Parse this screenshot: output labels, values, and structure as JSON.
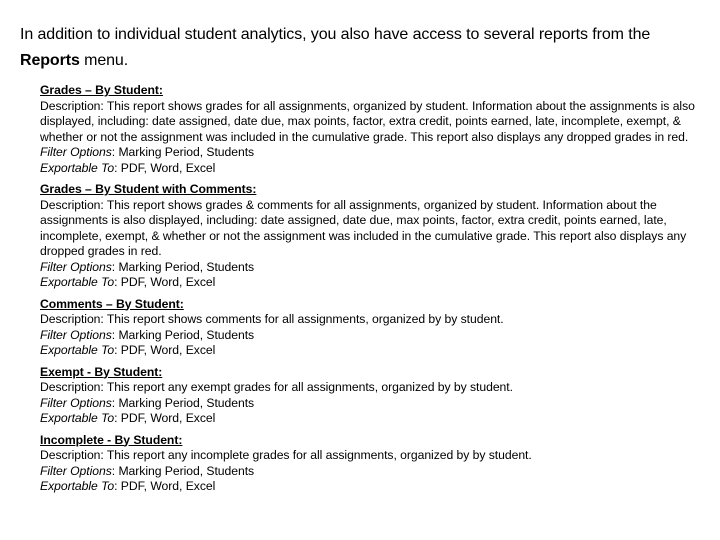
{
  "intro": {
    "before_bold": "In addition to individual student analytics, you also have access to several reports from the ",
    "bold": "Reports",
    "after_bold": " menu."
  },
  "reports": [
    {
      "title": "Grades – By Student:",
      "description": "Description: This report shows grades for all assignments, organized by student. Information about the assignments is also displayed, including: date assigned, date due, max points, factor, extra credit, points earned, late, incomplete, exempt, & whether or not the assignment was included in the cumulative grade. This report also displays any dropped grades in red.",
      "filter_label": "Filter Options",
      "filter_value": ": Marking Period, Students",
      "export_label": "Exportable To",
      "export_value": ": PDF, Word, Excel"
    },
    {
      "title": "Grades – By Student with Comments:",
      "description": "Description: This report shows grades & comments for all assignments, organized by student. Information about the assignments is also displayed, including: date assigned, date due, max points, factor, extra credit, points earned, late, incomplete, exempt, & whether or not the assignment was included in the cumulative grade. This report also displays any dropped grades in red.",
      "filter_label": "Filter Options",
      "filter_value": ": Marking Period, Students",
      "export_label": "Exportable To",
      "export_value": ": PDF, Word, Excel"
    },
    {
      "title": "Comments – By Student:",
      "description": "Description: This report shows comments for all assignments, organized by by student.",
      "filter_label": "Filter Options",
      "filter_value": ": Marking Period, Students",
      "export_label": "Exportable To",
      "export_value": ": PDF, Word, Excel"
    },
    {
      "title": "Exempt - By Student:",
      "description": "Description: This report any exempt grades for all assignments, organized by by student.",
      "filter_label": "Filter Options",
      "filter_value": ": Marking Period, Students",
      "export_label": "Exportable To",
      "export_value": ": PDF, Word, Excel"
    },
    {
      "title": "Incomplete - By Student:",
      "description": "Description: This report any incomplete grades for all assignments, organized by by student.",
      "filter_label": "Filter Options",
      "filter_value": ": Marking Period, Students",
      "export_label": "Exportable To",
      "export_value": ": PDF, Word, Excel"
    }
  ]
}
